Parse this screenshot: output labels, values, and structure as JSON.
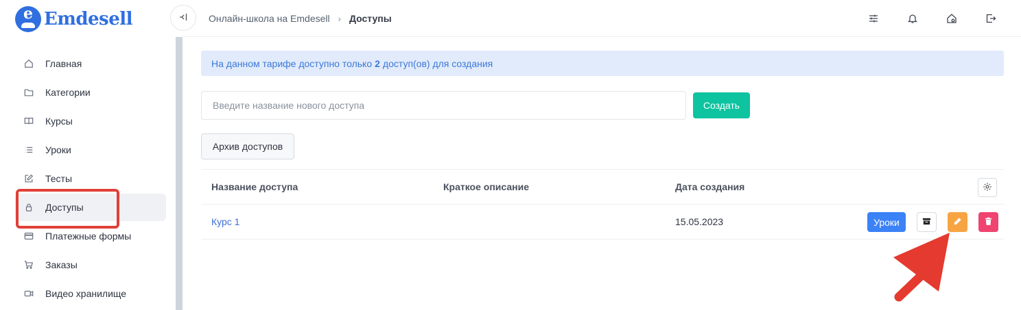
{
  "brand": {
    "name": "Emdesell",
    "logo_letter": "e",
    "color": "#2f6fe0"
  },
  "sidebar": {
    "items": [
      {
        "label": "Главная",
        "icon": "home-icon"
      },
      {
        "label": "Категории",
        "icon": "folder-icon"
      },
      {
        "label": "Курсы",
        "icon": "book-icon"
      },
      {
        "label": "Уроки",
        "icon": "list-icon"
      },
      {
        "label": "Тесты",
        "icon": "edit-icon"
      },
      {
        "label": "Доступы",
        "icon": "lock-icon",
        "active": true
      },
      {
        "label": "Платежные формы",
        "icon": "credit-card-icon"
      },
      {
        "label": "Заказы",
        "icon": "cart-icon"
      },
      {
        "label": "Видео хранилище",
        "icon": "video-icon"
      }
    ]
  },
  "header": {
    "collapse_icon": "collapse-left-icon",
    "breadcrumb": {
      "parent": "Онлайн-школа на Emdesell",
      "current": "Доступы"
    },
    "icons": [
      "sliders-icon",
      "bell-icon",
      "home-settings-icon",
      "logout-icon"
    ]
  },
  "main": {
    "alert": {
      "before": "На данном тарифе доступно только",
      "count": "2",
      "after": "доступ(ов) для создания"
    },
    "create": {
      "placeholder": "Введите название нового доступа",
      "value": "",
      "button_label": "Создать"
    },
    "archive_button_label": "Архив доступов",
    "table": {
      "columns": [
        "Название доступа",
        "Краткое описание",
        "Дата создания"
      ],
      "rows": [
        {
          "name": "Курс 1",
          "description": "",
          "date": "15.05.2023",
          "lessons_label": "Уроки"
        }
      ]
    }
  },
  "colors": {
    "accent_blue": "#3b82f6",
    "create_green": "#0ec3a0",
    "edit_orange": "#f7a543",
    "delete_pink": "#ef4470",
    "annotation_red": "#e04038"
  }
}
